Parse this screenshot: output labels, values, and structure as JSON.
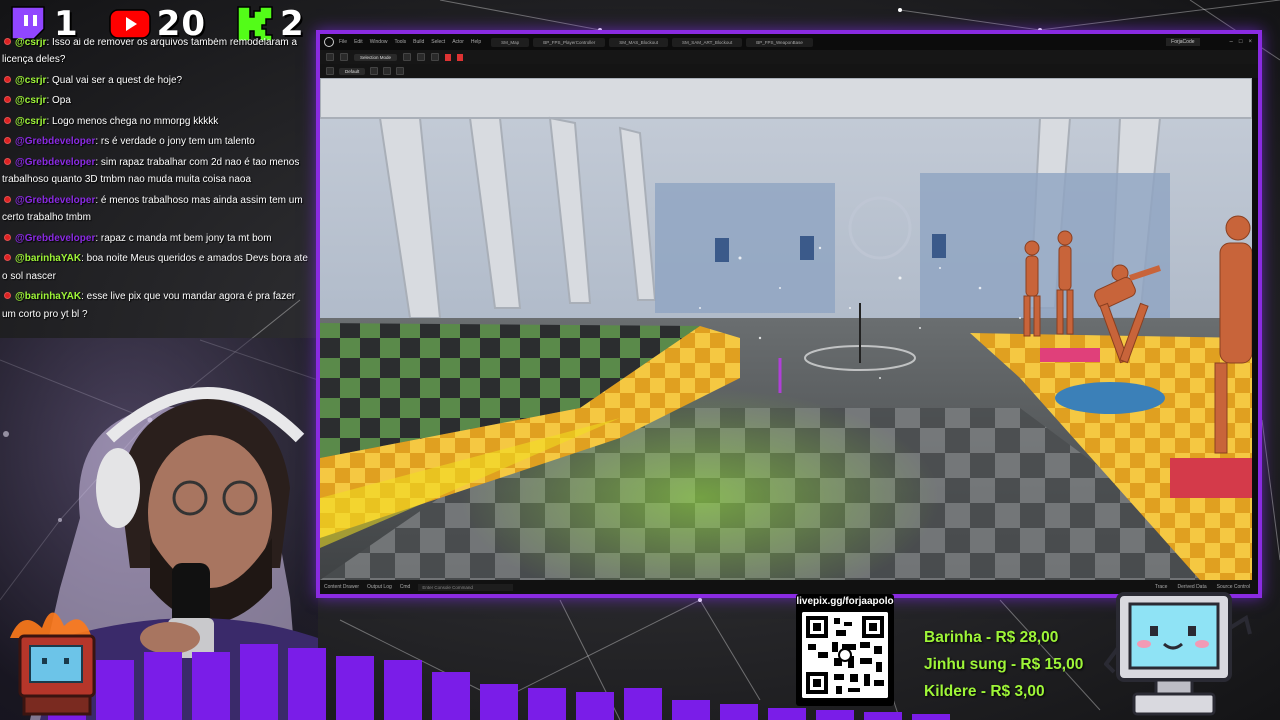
{
  "stats": {
    "twitch_count": "1",
    "youtube_count": "20",
    "kick_count": "2",
    "colors": {
      "twitch": "#9146ff",
      "youtube": "#ff0000",
      "kick": "#53fc18"
    }
  },
  "chat": {
    "messages": [
      {
        "user": "@csrjr",
        "user_color": "#9ef538",
        "text": ": Isso ai de remover os arquivos também remodelaram a licença deles?"
      },
      {
        "user": "@csrjr",
        "user_color": "#9ef538",
        "text": ": Qual vai ser a quest de hoje?"
      },
      {
        "user": "@csrjr",
        "user_color": "#9ef538",
        "text": ": Opa"
      },
      {
        "user": "@csrjr",
        "user_color": "#9ef538",
        "text": ": Logo menos chega no mmorpg kkkkk"
      },
      {
        "user": "@Grebdeveloper",
        "user_color": "#8a2be2",
        "text": ": rs é verdade o jony tem um talento"
      },
      {
        "user": "@Grebdeveloper",
        "user_color": "#8a2be2",
        "text": ": sim rapaz trabalhar com 2d nao é tao menos trabalhoso quanto 3D tmbm nao muda muita coisa naoa"
      },
      {
        "user": "@Grebdeveloper",
        "user_color": "#8a2be2",
        "text": ": é menos trabalhoso mas ainda assim tem um certo trabalho tmbm"
      },
      {
        "user": "@Grebdeveloper",
        "user_color": "#8a2be2",
        "text": ": rapaz c manda mt bem jony ta mt bom"
      },
      {
        "user": "@barinhaYAK",
        "user_color": "#9ef538",
        "text": ": boa noite Meus queridos e amados Devs bora ate o sol nascer"
      },
      {
        "user": "@barinhaYAK",
        "user_color": "#9ef538",
        "text": ": esse live pix que vou mandar agora é pra fazer um corto pro yt bl ?"
      }
    ]
  },
  "editor": {
    "menu": [
      "File",
      "Edit",
      "Window",
      "Tools",
      "Build",
      "Select",
      "Actor",
      "Help"
    ],
    "tabs": [
      "SM_Map",
      "BP_FPS_PlayerController",
      "SM_MAS_Blockout",
      "SM_SAM_ART_Blockout",
      "BP_FPS_WeaponBase"
    ],
    "project": "ForjaCode",
    "mode_label": "Selection Mode",
    "viewport_label": "Default",
    "status_items": [
      "Content Drawer",
      "Output Log",
      "Cmd"
    ],
    "cmd_placeholder": "Enter Console Command",
    "status_right": [
      "Trace",
      "Derived Data",
      "Source Control"
    ],
    "accent_color": "#8a2be2"
  },
  "livepix": {
    "label": "livepix.gg/forjaapolo"
  },
  "donations": {
    "items": [
      "Barinha - R$ 28,00",
      "Jinhu sung - R$ 15,00",
      "Kildere - R$ 3,00"
    ],
    "color": "#9ef538"
  },
  "equalizer": {
    "levels": [
      0.5,
      0.75,
      0.85,
      0.85,
      0.95,
      0.9,
      0.8,
      0.75,
      0.6,
      0.45,
      0.4,
      0.35,
      0.4,
      0.25,
      0.2,
      0.15,
      0.12,
      0.1,
      0.08,
      0.06
    ],
    "color": "#7a1de8"
  }
}
